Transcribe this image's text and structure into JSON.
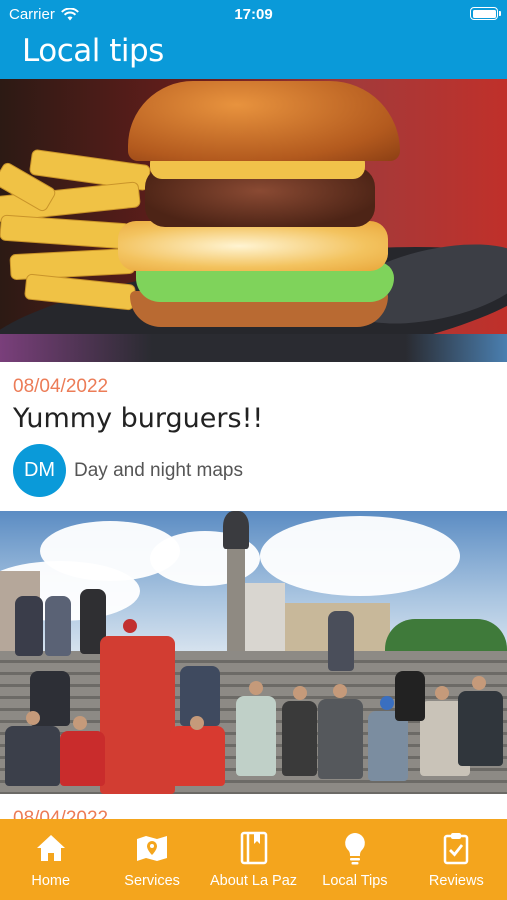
{
  "status_bar": {
    "carrier": "Carrier",
    "time": "17:09"
  },
  "header": {
    "title": "Local tips"
  },
  "posts": [
    {
      "date": "08/04/2022",
      "title": "Yummy burguers!!",
      "author_initials": "DM",
      "author_name": "Day and night maps"
    },
    {
      "date": "08/04/2022"
    }
  ],
  "tabs": [
    {
      "label": "Home",
      "icon": "home-icon"
    },
    {
      "label": "Services",
      "icon": "map-pin-icon"
    },
    {
      "label": "About La Paz",
      "icon": "book-icon"
    },
    {
      "label": "Local Tips",
      "icon": "lightbulb-icon"
    },
    {
      "label": "Reviews",
      "icon": "clipboard-check-icon"
    }
  ],
  "colors": {
    "header": "#0a9ad9",
    "tabbar": "#f4a51d",
    "date": "#ec7c57",
    "avatar": "#0a9ad9"
  }
}
